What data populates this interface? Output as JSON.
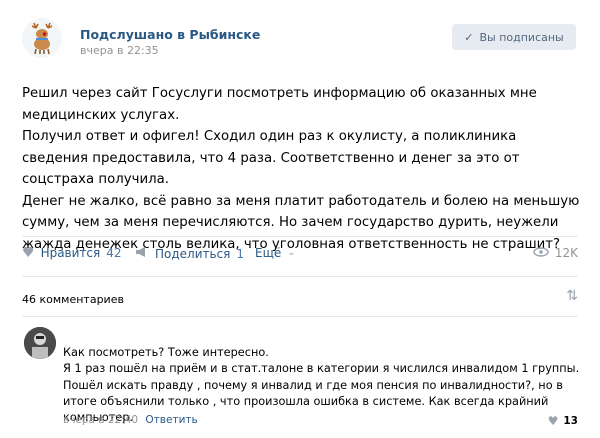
{
  "post": {
    "group_name": "Подслушано в Рыбинске",
    "time": "вчера в 22:35",
    "subscribed_label": "Вы подписаны",
    "text_lines": [
      "Решил через сайт Госуслуги посмотреть информацию об оказанных мне медицинских услугах.",
      "Получил ответ и офигел! Сходил один раз к окулисту, а поликлиника сведения предоставила, что 4 раза. Соответственно и денег за это от соцстраха получила.",
      "Денег не жалко, всё равно за меня платит работодатель и болею на меньшую сумму, чем за меня перечисляются. Но зачем государство дурить, неужели жажда денежек столь велика, что уголовная ответственность не страшит?"
    ]
  },
  "actions": {
    "like_label": "Нравится",
    "like_count": "42",
    "share_label": "Поделиться",
    "share_count": "1",
    "more_label": "Ещё",
    "views": "12K"
  },
  "comments": {
    "count_label": "46 комментариев",
    "items": [
      {
        "lines": [
          "Как посмотреть? Тоже интересно.",
          "Я 1 раз пошёл на приём и в стат.талоне в категории я числился инвалидом 1 группы.",
          "Пошёл искать правду , почему я инвалид и где моя пенсия по инвалидности?, но в итоге объяснили только , что произошла ошибка в системе. Как всегда крайний компьютер."
        ],
        "time": "вчера в 22:40",
        "reply_label": "Ответить",
        "likes": "13"
      }
    ]
  },
  "colors": {
    "link": "#2a5885",
    "muted": "#939393",
    "button_bg": "#e5ebf1"
  },
  "icons": [
    "deer-avatar",
    "check-icon",
    "heart-icon",
    "megaphone-icon",
    "chevron-down-icon",
    "eye-icon",
    "sort-icon",
    "user-avatar"
  ]
}
